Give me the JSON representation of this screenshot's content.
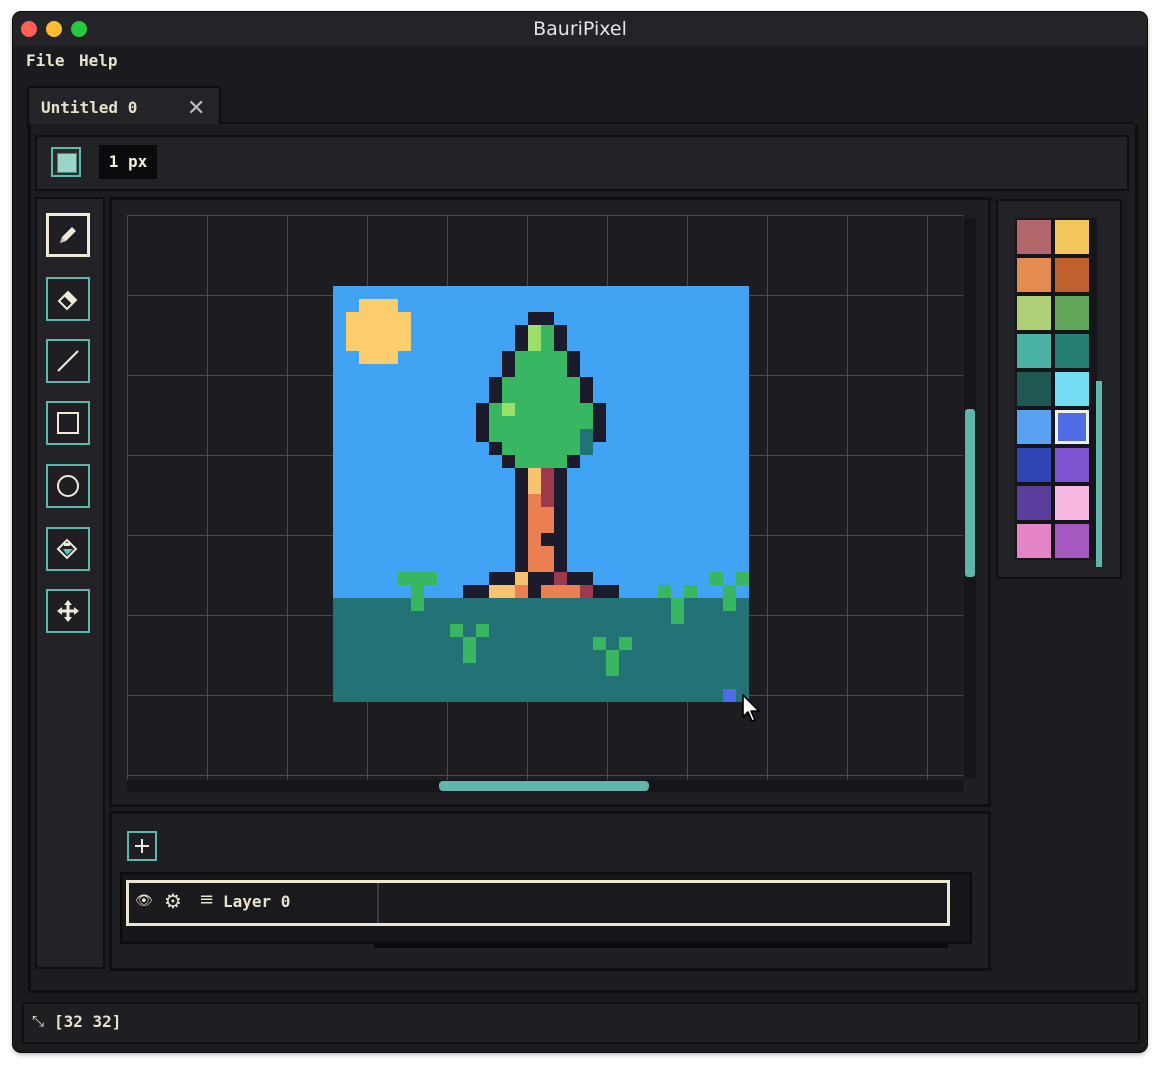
{
  "window": {
    "title": "BauriPixel"
  },
  "menu": {
    "items": [
      "File",
      "Help"
    ]
  },
  "tabs": [
    {
      "label": "Untitled 0"
    }
  ],
  "toolbar": {
    "brush_size": "1 px"
  },
  "tools": [
    {
      "name": "pencil-tool",
      "icon": "pencil-icon",
      "active": true
    },
    {
      "name": "eraser-tool",
      "icon": "eraser-icon",
      "active": false
    },
    {
      "name": "line-tool",
      "icon": "line-icon",
      "active": false
    },
    {
      "name": "rectangle-tool",
      "icon": "rectangle-icon",
      "active": false
    },
    {
      "name": "ellipse-tool",
      "icon": "circle-icon",
      "active": false
    },
    {
      "name": "fill-tool",
      "icon": "paint-bucket-icon",
      "active": false
    },
    {
      "name": "move-tool",
      "icon": "move-icon",
      "active": false
    }
  ],
  "palette": {
    "colors": [
      "#b2676c",
      "#f4c75c",
      "#e48b52",
      "#c0612f",
      "#b0d078",
      "#62a759",
      "#4bb2a6",
      "#267f72",
      "#1f5853",
      "#74dcf3",
      "#58a2f1",
      "#4e6ce6",
      "#2f45b3",
      "#7e54d1",
      "#5b3d9c",
      "#f6b8e0",
      "#e485c6",
      "#a558c0"
    ],
    "selected_index": 11
  },
  "layers": [
    {
      "name": "Layer 0",
      "visible": true
    }
  ],
  "status": {
    "canvas_size": "[32 32]"
  },
  "colors": {
    "accent": "#5fb6ac",
    "sky": "#41a3f3",
    "ground": "#237275",
    "sun": "#fccd6c",
    "leaf": "#38b662",
    "leaf_light": "#9ce06b",
    "outline": "#1b1b2b",
    "trunk": "#ea7f52",
    "trunk_dark": "#9c394d",
    "trunk_light": "#f6c371",
    "grass": "#38b662"
  }
}
